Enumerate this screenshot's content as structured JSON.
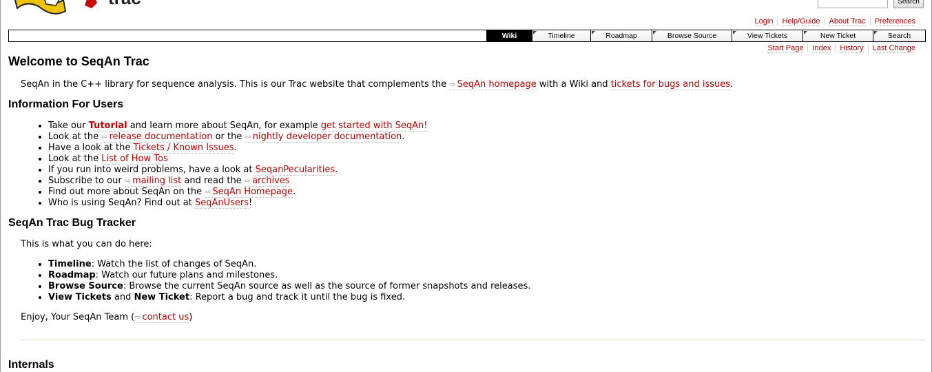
{
  "logo_alt": "SeqAn Trac",
  "search": {
    "button": "Search",
    "placeholder": ""
  },
  "metanav": [
    "Login",
    "Help/Guide",
    "About Trac",
    "Preferences"
  ],
  "mainnav": [
    "Wiki",
    "Timeline",
    "Roadmap",
    "Browse Source",
    "View Tickets",
    "New Ticket",
    "Search"
  ],
  "ctxtnav": [
    "Start Page",
    "Index",
    "History",
    "Last Change"
  ],
  "title": "Welcome to SeqAn Trac",
  "intro": {
    "t1": "SeqAn in the C++ library for sequence analysis. This is our Trac website that complements the ",
    "link1": "SeqAn homepage",
    "t2": " with a Wiki and ",
    "link2": "tickets for bugs and issues",
    "t3": "."
  },
  "users": {
    "heading": "Information For Users",
    "i1": {
      "t1": "Take our ",
      "link1": "Tutorial",
      "t2": " and learn more about SeqAn, for example ",
      "link2": "get started with SeqAn!"
    },
    "i2": {
      "t1": "Look at the ",
      "link1": "release documentation",
      "t2": " or the ",
      "link2": "nightly developer documentation",
      "t3": "."
    },
    "i3": {
      "t1": "Have a look at the ",
      "link1": "Tickets / Known Issues",
      "t2": "."
    },
    "i4": {
      "t1": "Look at the ",
      "link1": "List of How Tos"
    },
    "i5": {
      "t1": "If you run into weird problems, have a look at ",
      "link1": "SeqanPecularities",
      "t2": "."
    },
    "i6": {
      "t1": "Subscribe to our ",
      "link1": "mailing list",
      "t2": " and read the ",
      "link2": "archives"
    },
    "i7": {
      "t1": "Find out more about SeqAn on the ",
      "link1": "SeqAn Homepage",
      "t2": "."
    },
    "i8": {
      "t1": "Who is using SeqAn? Find out at ",
      "link1": "SeqAnUsers",
      "t2": "!"
    }
  },
  "tracker": {
    "heading": "SeqAn Trac Bug Tracker",
    "intro": "This is what you can do here:",
    "i1": {
      "b1": "Timeline",
      "t1": ": Watch the list of changes of SeqAn."
    },
    "i2": {
      "b1": "Roadmap",
      "t1": ": Watch our future plans and milestones."
    },
    "i3": {
      "b1": "Browse Source",
      "t1": ": Browse the current SeqAn source as well as the source of former snapshots and releases."
    },
    "i4": {
      "b1": "View Tickets",
      "t1": " and ",
      "b2": "New Ticket",
      "t2": ": Report a bug and track it until the bug is fixed."
    },
    "enjoy": {
      "t1": "Enjoy, Your SeqAn Team (",
      "link1": "contact us",
      "t2": ")"
    }
  },
  "internals_heading": "Internals",
  "colors": {
    "link": "#bb0000",
    "nav_active": "#000000"
  }
}
